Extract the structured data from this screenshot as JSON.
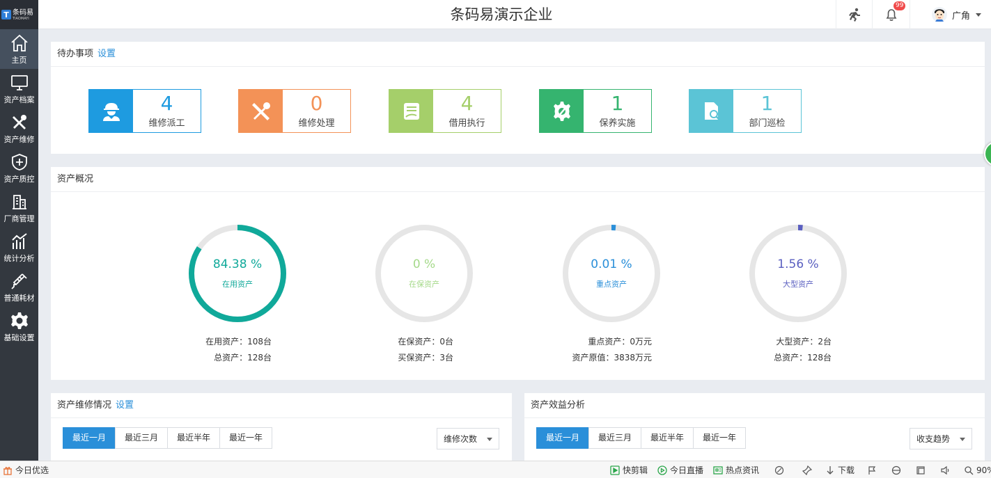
{
  "app": {
    "logo_cn": "条码易",
    "logo_en": "TIAOMAYI",
    "title": "条码易演示企业",
    "notification_count": "99",
    "user_name": "广角"
  },
  "sidebar": {
    "items": [
      {
        "label": "主页",
        "icon": "home-icon"
      },
      {
        "label": "资产档案",
        "icon": "monitor-icon"
      },
      {
        "label": "资产维修",
        "icon": "tools-icon"
      },
      {
        "label": "资产质控",
        "icon": "shield-plus-icon"
      },
      {
        "label": "厂商管理",
        "icon": "building-icon"
      },
      {
        "label": "统计分析",
        "icon": "chart-icon"
      },
      {
        "label": "普通耗材",
        "icon": "syringe-icon"
      },
      {
        "label": "基础设置",
        "icon": "gear-icon"
      }
    ]
  },
  "todo": {
    "title": "待办事项",
    "settings_link": "设置",
    "cards": [
      {
        "count": "4",
        "label": "维修派工",
        "color": "#1e9be0"
      },
      {
        "count": "0",
        "label": "维修处理",
        "color": "#f39257"
      },
      {
        "count": "4",
        "label": "借用执行",
        "color": "#a5cf6a"
      },
      {
        "count": "1",
        "label": "保养实施",
        "color": "#35b46f"
      },
      {
        "count": "1",
        "label": "部门巡检",
        "color": "#5bc4d6"
      }
    ]
  },
  "overview": {
    "title": "资产概况",
    "gauges": [
      {
        "percent_text": "84.38 %",
        "percent": 84.38,
        "name": "在用资产",
        "color": "#10a99a",
        "stat1": "在用资产：108台",
        "stat2": "总资产：128台"
      },
      {
        "percent_text": "0 %",
        "percent": 0,
        "name": "在保资产",
        "color": "#a5d98a",
        "stat1": "在保资产：0台",
        "stat2": "买保资产：3台"
      },
      {
        "percent_text": "0.01 %",
        "percent": 0.01,
        "name": "重点资产",
        "color": "#2a8fd9",
        "stat1": "重点资产：0万元",
        "stat2": "资产原值：3838万元"
      },
      {
        "percent_text": "1.56 %",
        "percent": 1.56,
        "name": "大型资产",
        "color": "#5a5fc0",
        "stat1": "大型资产：2台",
        "stat2": "总资产：128台"
      }
    ]
  },
  "repair": {
    "title": "资产维修情况",
    "settings_link": "设置",
    "tabs": [
      "最近一月",
      "最近三月",
      "最近半年",
      "最近一年"
    ],
    "select_value": "维修次数"
  },
  "benefit": {
    "title": "资产效益分析",
    "tabs": [
      "最近一月",
      "最近三月",
      "最近半年",
      "最近一年"
    ],
    "select_value": "收支趋势"
  },
  "bottombar": {
    "left": "今日优选",
    "kuaijianji": "快剪辑",
    "zhibo": "今日直播",
    "redian": "热点资讯",
    "download": "下载",
    "zoom": "90%"
  }
}
